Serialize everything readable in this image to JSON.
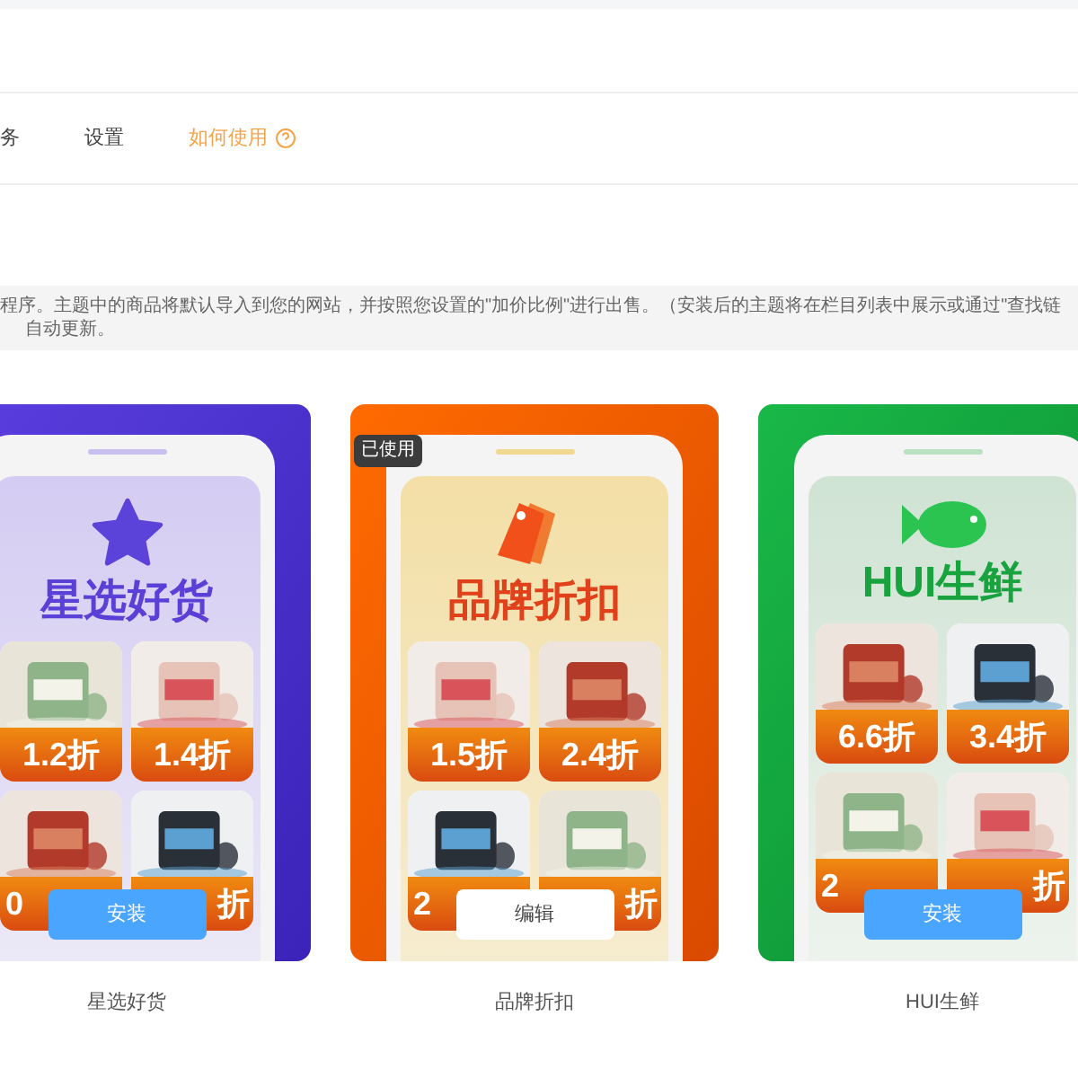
{
  "tabs": [
    {
      "label": "务",
      "selected": false
    },
    {
      "label": "设置",
      "selected": false
    }
  ],
  "help_link": {
    "label": "如何使用"
  },
  "notice": {
    "lines": [
      "程序。主题中的商品将默认导入到您的网站，并按照您设置的\"加价比例\"进行出售。（安装后的主题将在栏目列表中展示或通过\"查找链",
      "自动更新。"
    ]
  },
  "themes": [
    {
      "name": "星选好货",
      "kind": "purple",
      "title": "星选好货",
      "action": {
        "label": "安装",
        "kind": "primary"
      },
      "tiles": [
        "1.2折",
        "1.4折",
        "0",
        "折"
      ]
    },
    {
      "name": "品牌折扣",
      "kind": "orange",
      "title": "品牌折扣",
      "badge": "已使用",
      "action": {
        "label": "编辑",
        "kind": "secondary"
      },
      "tiles": [
        "1.5折",
        "2.4折",
        "2",
        "折"
      ]
    },
    {
      "name": "HUI生鲜",
      "kind": "green",
      "title": "HUI生鲜",
      "action": {
        "label": "安装",
        "kind": "primary"
      },
      "tiles": [
        "6.6折",
        "3.4折",
        "2",
        "折"
      ]
    }
  ]
}
